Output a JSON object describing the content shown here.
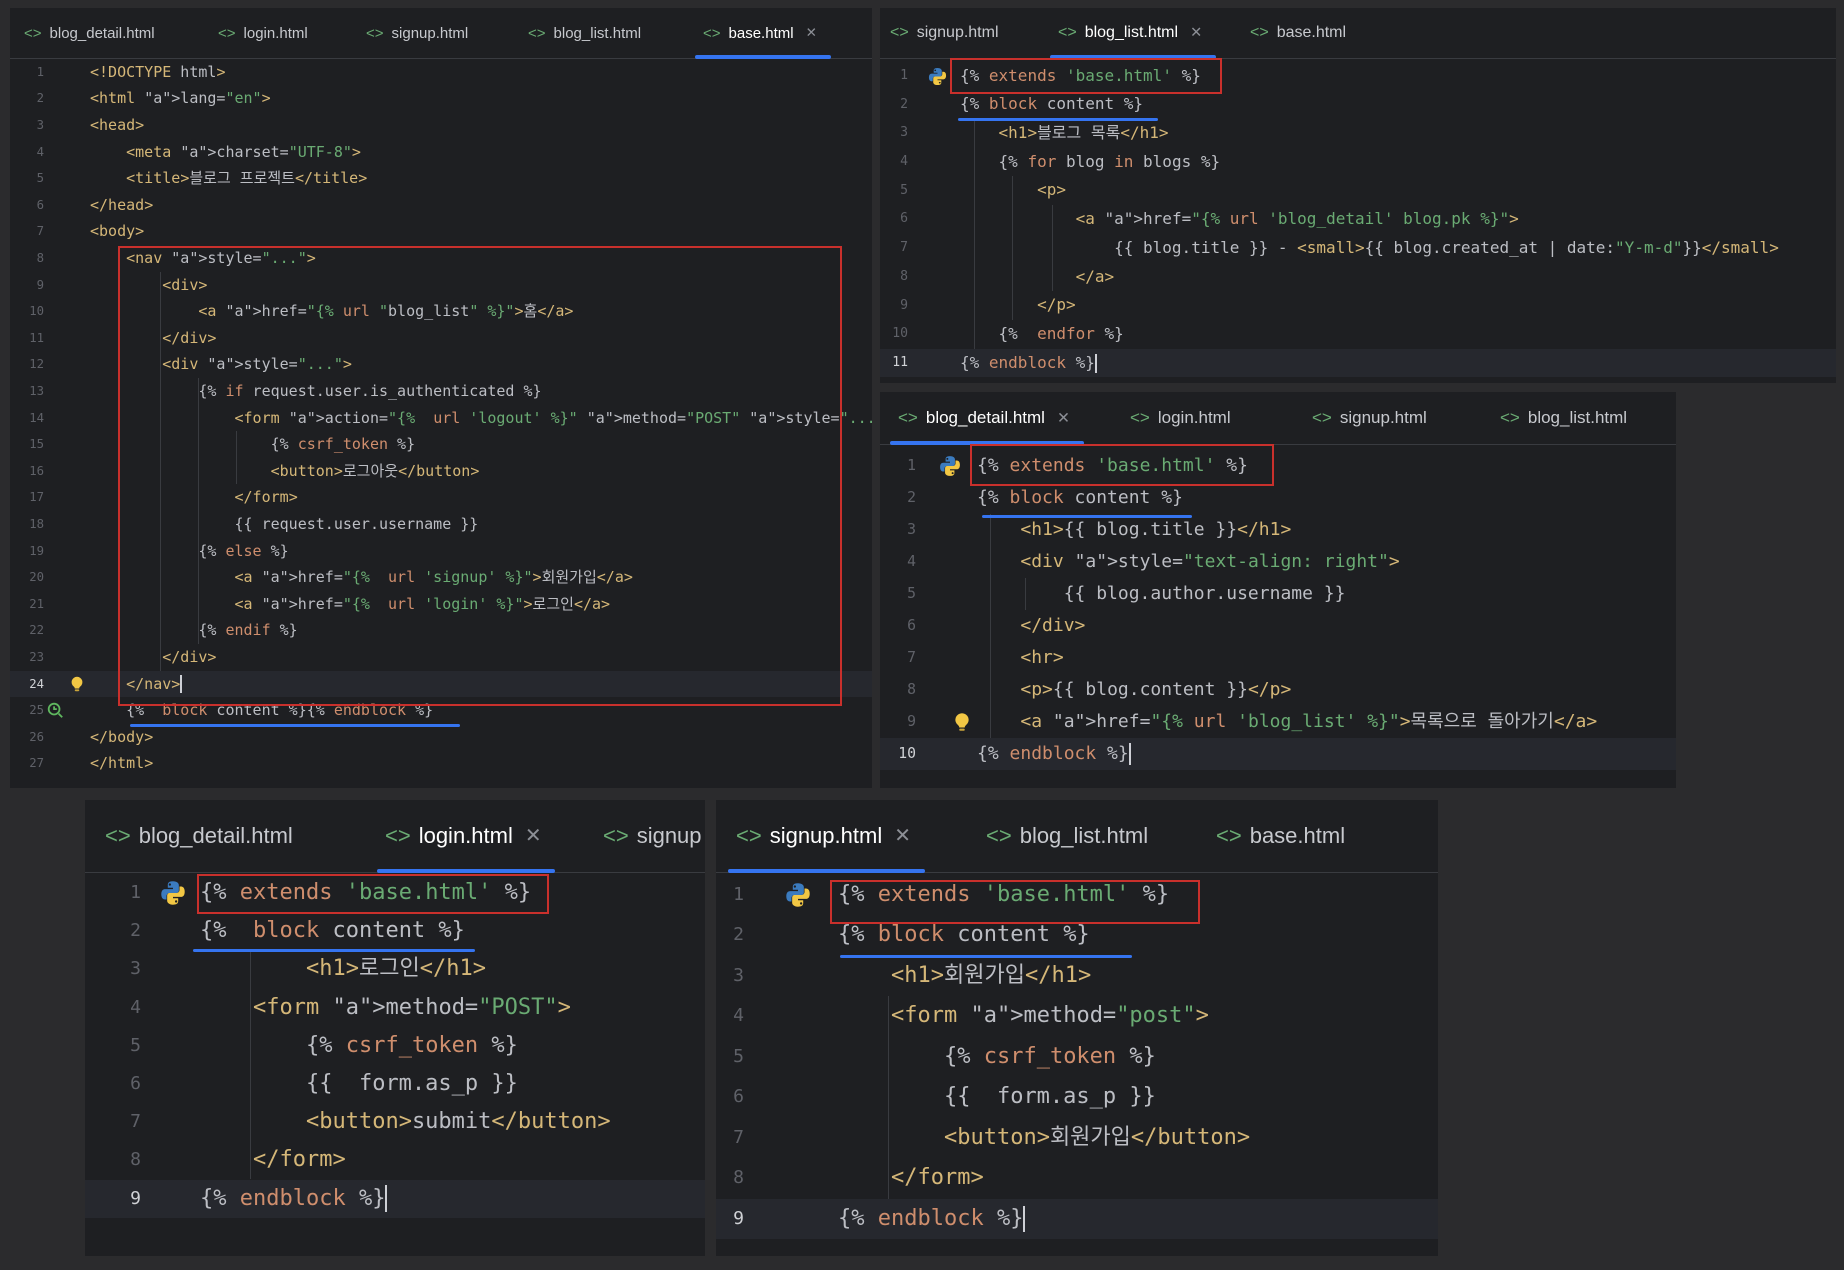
{
  "panels": {
    "base": {
      "tabs": [
        {
          "label": "blog_detail.html",
          "active": false
        },
        {
          "label": "login.html",
          "active": false
        },
        {
          "label": "signup.html",
          "active": false
        },
        {
          "label": "blog_list.html",
          "active": false
        },
        {
          "label": "base.html",
          "active": true,
          "closable": true
        }
      ],
      "line_numbers": [
        "1",
        "2",
        "3",
        "4",
        "5",
        "6",
        "7",
        "8",
        "9",
        "10",
        "11",
        "12",
        "13",
        "14",
        "15",
        "16",
        "17",
        "18",
        "19",
        "20",
        "21",
        "22",
        "23",
        "24",
        "25",
        "26",
        "27"
      ],
      "lines": [
        "<!DOCTYPE html>",
        "<html lang=\"en\">",
        "<head>",
        "    <meta charset=\"UTF-8\">",
        "    <title>블로그 프로젝트</title>",
        "</head>",
        "<body>",
        "    <nav style=\"...\">",
        "        <div>",
        "            <a href=\"{% url \"blog_list\" %}\">홈</a>",
        "        </div>",
        "        <div style=\"...\">",
        "            {% if request.user.is_authenticated %}",
        "                <form action=\"{%  url 'logout' %}\" method=\"POST\" style=\"...\">",
        "                    {% csrf_token %}",
        "                    <button>로그아웃</button>",
        "                </form>",
        "                {{ request.user.username }}",
        "            {% else %}",
        "                <a href=\"{%  url 'signup' %}\">회원가입</a>",
        "                <a href=\"{%  url 'login' %}\">로그인</a>",
        "            {% endif %}",
        "        </div>",
        "    </nav>",
        "    {%  block content %}{% endblock %}",
        "</body>",
        "</html>"
      ]
    },
    "blog_list": {
      "tabs": [
        {
          "label": "signup.html",
          "active": false
        },
        {
          "label": "blog_list.html",
          "active": true,
          "closable": true
        },
        {
          "label": "base.html",
          "active": false
        }
      ],
      "line_numbers": [
        "1",
        "2",
        "3",
        "4",
        "5",
        "6",
        "7",
        "8",
        "9",
        "10",
        "11"
      ],
      "lines": [
        "{% extends 'base.html' %}",
        "{% block content %}",
        "    <h1>블로그 목록</h1>",
        "    {% for blog in blogs %}",
        "        <p>",
        "            <a href=\"{% url 'blog_detail' blog.pk %}\">",
        "                {{ blog.title }} - <small>{{ blog.created_at | date:\"Y-m-d\"}}</small>",
        "            </a>",
        "        </p>",
        "    {%  endfor %}",
        "{% endblock %}"
      ]
    },
    "blog_detail": {
      "tabs": [
        {
          "label": "blog_detail.html",
          "active": true,
          "closable": true
        },
        {
          "label": "login.html",
          "active": false
        },
        {
          "label": "signup.html",
          "active": false
        },
        {
          "label": "blog_list.html",
          "active": false
        }
      ],
      "line_numbers": [
        "1",
        "2",
        "3",
        "4",
        "5",
        "6",
        "7",
        "8",
        "9",
        "10"
      ],
      "lines": [
        "{% extends 'base.html' %}",
        "{% block content %}",
        "    <h1>{{ blog.title }}</h1>",
        "    <div style=\"text-align: right\">",
        "        {{ blog.author.username }}",
        "    </div>",
        "    <hr>",
        "    <p>{{ blog.content }}</p>",
        "    <a href=\"{% url 'blog_list' %}\">목록으로 돌아가기</a>",
        "{% endblock %}"
      ]
    },
    "login": {
      "tabs": [
        {
          "label": "blog_detail.html",
          "active": false
        },
        {
          "label": "login.html",
          "active": true,
          "closable": true
        },
        {
          "label": "signup",
          "active": false
        }
      ],
      "line_numbers": [
        "1",
        "2",
        "3",
        "4",
        "5",
        "6",
        "7",
        "8",
        "9"
      ],
      "lines": [
        "{% extends 'base.html' %}",
        "{%  block content %}",
        "        <h1>로그인</h1>",
        "    <form method=\"POST\">",
        "        {% csrf_token %}",
        "        {{  form.as_p }}",
        "        <button>submit</button>",
        "    </form>",
        "{% endblock %}"
      ]
    },
    "signup": {
      "tabs": [
        {
          "label": "signup.html",
          "active": true,
          "closable": true
        },
        {
          "label": "blog_list.html",
          "active": false
        },
        {
          "label": "base.html",
          "active": false
        }
      ],
      "line_numbers": [
        "1",
        "2",
        "3",
        "4",
        "5",
        "6",
        "7",
        "8",
        "9"
      ],
      "lines": [
        "{% extends 'base.html' %}",
        "{% block content %}",
        "    <h1>회원가입</h1>",
        "    <form method=\"post\">",
        "        {% csrf_token %}",
        "        {{  form.as_p }}",
        "        <button>회원가입</button>",
        "    </form>",
        "{% endblock %}"
      ]
    }
  },
  "icons": {
    "file_tab": "html-file-icon",
    "close": "close-icon",
    "gutter_python": "python-icon",
    "gutter_bulb": "lightbulb-icon",
    "gutter_fold": "override-icon"
  },
  "colors": {
    "editor_bg": "#1e1f22",
    "tag": "#d5b778",
    "keyword": "#cf8e6d",
    "string": "#6aab73",
    "highlight_box": "#c9302c",
    "accent_underline": "#3574f0"
  }
}
